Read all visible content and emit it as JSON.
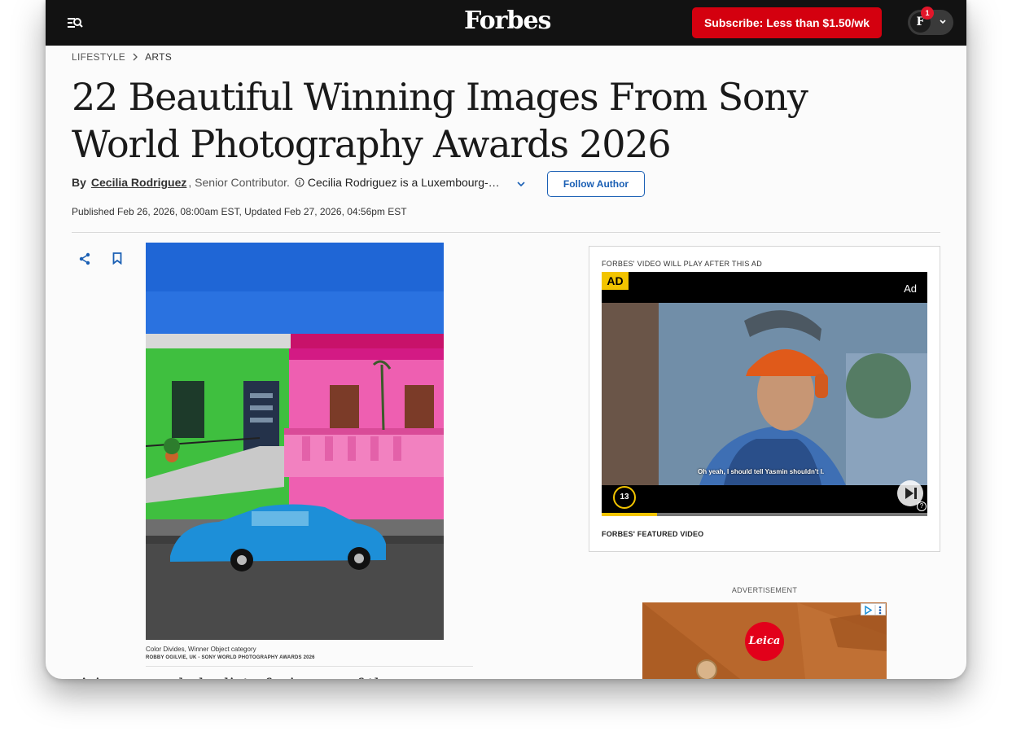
{
  "header": {
    "logo": "Forbes",
    "subscribe_label": "Subscribe: Less than $1.50/wk",
    "avatar_letter": "F",
    "notification_count": "1"
  },
  "breadcrumb": {
    "section": "LIFESTYLE",
    "subsection": "ARTS"
  },
  "article": {
    "title": "22 Beautiful Winning Images From Sony World Photography Awards 2026",
    "by": "By",
    "author": "Cecilia Rodriguez",
    "role": ", Senior Contributor.",
    "bio": "Cecilia Rodriguez is a Luxembourg-based writer",
    "follow_label": "Follow Author",
    "published": "Published Feb 26, 2026, 08:00am EST, Updated Feb 27, 2026, 04:56pm EST",
    "photo_caption": "Color Divides, Winner Object category",
    "photo_credit": "ROBBY OGILVIE, UK - SONY WORLD PHOTOGRAPHY AWARDS 2026",
    "body_start": "A jury revealed a list of winners of the open and youth competition"
  },
  "video": {
    "notice": "FORBES' VIDEO WILL PLAY AFTER THIS AD",
    "ad_tag": "AD",
    "ad_label": "Ad",
    "subtitle": "Oh yeah, I should tell Yasmin shouldn't I.",
    "countdown": "13",
    "progress": 0.17,
    "help": "?",
    "featured_label": "FORBES' FEATURED VIDEO"
  },
  "advertisement": {
    "label": "ADVERTISEMENT",
    "brand": "Leica"
  },
  "colors": {
    "topbar": "#121212",
    "subscribe": "#d4000f",
    "link_blue": "#1a5fb4",
    "ad_yellow": "#f2c400"
  }
}
